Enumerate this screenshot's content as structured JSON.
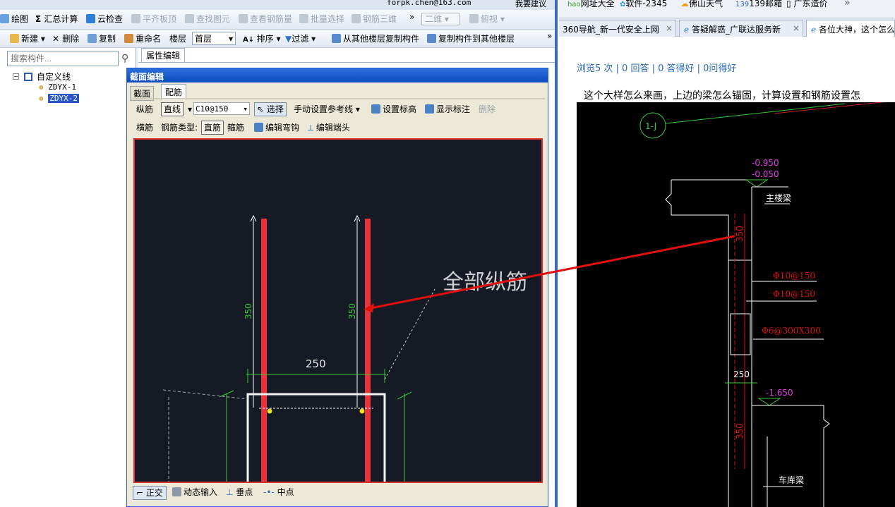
{
  "left_app": {
    "topbar": {
      "email": "forpk.chen@163.com",
      "suggest": "我要建议"
    },
    "toolbar1": [
      "绘图",
      "汇总计算",
      "云检查",
      "平齐板顶",
      "查找图元",
      "查看钢筋量",
      "批量选择",
      "钢筋三维",
      "二维",
      "俯视"
    ],
    "toolbar2": {
      "new": "新建",
      "delete": "删除",
      "copy": "复制",
      "rename": "重命名",
      "floor_label": "楼层",
      "floor_value": "首层",
      "sort": "排序",
      "filter": "过滤",
      "copy_from": "从其他楼层复制构件",
      "copy_to": "复制构件到其他楼层"
    },
    "search_placeholder": "搜索构件...",
    "tree": {
      "root": "自定义线",
      "items": [
        "ZDYX-1",
        "ZDYX-2"
      ]
    },
    "property_tab": "属性编辑",
    "dialog": {
      "title": "截面编辑",
      "tabs": [
        "截面",
        "配筋"
      ],
      "row1": {
        "label": "纵筋",
        "mode": "直线",
        "spec": "C10@150",
        "ref": "手动设置参考线",
        "set_elev": "设置标高",
        "show_ann": "显示标注",
        "del": "删除"
      },
      "row2": {
        "label": "横筋",
        "type_label": "钢筋类型:",
        "straight": "直筋",
        "stirrup": "箍筋",
        "edit_hook": "编辑弯钩",
        "edit_end": "编辑端头"
      },
      "canvas": {
        "dim_left": "350",
        "dim_right": "350",
        "dim_width": "250",
        "note": "全部纵筋"
      },
      "status": [
        "正交",
        "动态输入",
        "垂点",
        "中点"
      ]
    }
  },
  "right_browser": {
    "bookmarks": [
      "网址大全",
      "软件-2345",
      "佛山天气",
      "139邮箱",
      "广东造价"
    ],
    "tabs": [
      "360导航_新一代安全上网",
      "答疑解惑_广联达服务新",
      "各位大神，这个怎么"
    ],
    "stats": "浏览5 次 | 0 回答 | 0 答得好 | 0问得好",
    "question": "这个大样怎么来画，上边的梁怎么锚固，计算设置和钢筋设置怎",
    "cad": {
      "circle": "1-J",
      "elev1": "-0.950",
      "elev2": "-0.050",
      "main_beam": "主楼梁",
      "dim350a": "350",
      "rebar1": "Φ10@150",
      "rebar2": "Φ10@150",
      "stirrup": "Φ6@300X300",
      "dim250": "250",
      "elev3": "-1.650",
      "dim350b": "350",
      "garage_beam": "车库梁"
    }
  },
  "colors": {
    "canvas_bg": "#161a24",
    "rebar_red": "#e8333b",
    "dim_green": "#37c837",
    "cad_magenta": "#e040e0",
    "arrow_red": "#e01010"
  }
}
